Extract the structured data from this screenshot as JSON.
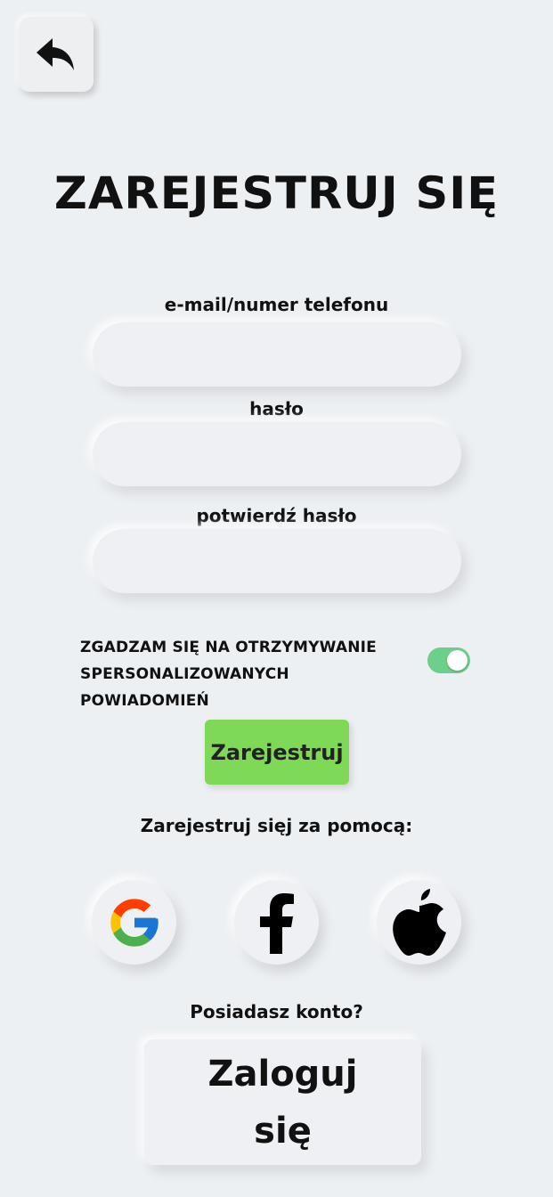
{
  "header": {
    "back_icon": "undo-arrow-icon",
    "title": "ZAREJESTRUJ SIĘ"
  },
  "form": {
    "email_label": "e-mail/numer telefonu",
    "email_value": "",
    "password_label": "hasło",
    "password_value": "",
    "confirm_label": "potwierdź hasło",
    "confirm_value": ""
  },
  "consent": {
    "line1": "ZGADZAM SIĘ NA OTRZYMYWANIE",
    "line2": "SPERSONALIZOWANYCH POWIADOMIEŃ",
    "toggle_on": true,
    "toggle_color": "#6ccf8a"
  },
  "actions": {
    "register_label": "Zarejestruj",
    "register_color": "#7ed957",
    "social_caption": "Zarejestruj sięj za pomocą:",
    "social": [
      {
        "name": "google",
        "icon": "google-icon"
      },
      {
        "name": "facebook",
        "icon": "facebook-icon"
      },
      {
        "name": "apple",
        "icon": "apple-icon"
      }
    ]
  },
  "footer": {
    "have_account": "Posiadasz konto?",
    "login_label": "Zaloguj się"
  }
}
